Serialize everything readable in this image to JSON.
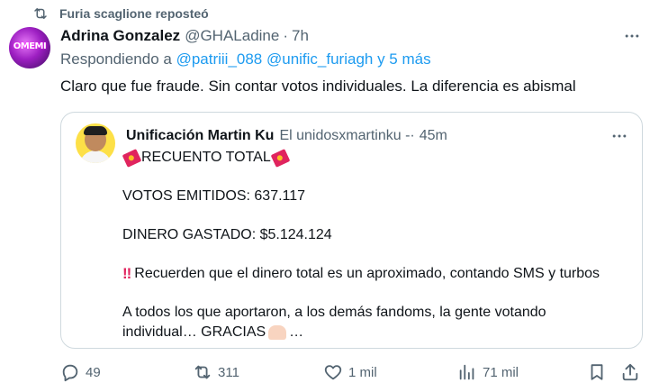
{
  "repost": {
    "icon": "repost-icon",
    "text": "Furia scaglione reposteó"
  },
  "tweet": {
    "author_name": "Adrina Gonzalez",
    "author_handle": "@GHALadine",
    "separator": "·",
    "time": "7h",
    "avatar_text": "OMEMI",
    "reply_prefix": "Respondiendo a",
    "reply_mentions": "@patriii_088 @unific_furiagh y 5 más",
    "text": "Claro que fue fraude. Sin contar votos individuales. La diferencia es abismal"
  },
  "quote": {
    "author_name": "Unificación Martin Ku",
    "author_handle": "El unidosxmartinku -·",
    "time": "45m",
    "line1": "RECUENTO TOTAL",
    "line2": "VOTOS EMITIDOS: 637.117",
    "line3": "DINERO GASTADO: $5.124.124",
    "line4": "Recuerden que el dinero total es un aproximado, contando SMS y turbos",
    "line5": "A todos los que aportaron, a los demás fandoms, la gente votando",
    "line6_text": "individual… GRACIAS",
    "line6_suffix": "…",
    "bangs": "‼"
  },
  "actions": {
    "replies": "49",
    "reposts": "311",
    "likes": "1 mil",
    "views": "71 mil"
  },
  "colors": {
    "link": "#1d9bf0",
    "muted": "#536471",
    "text": "#0f1419",
    "border": "#cfd9de"
  }
}
